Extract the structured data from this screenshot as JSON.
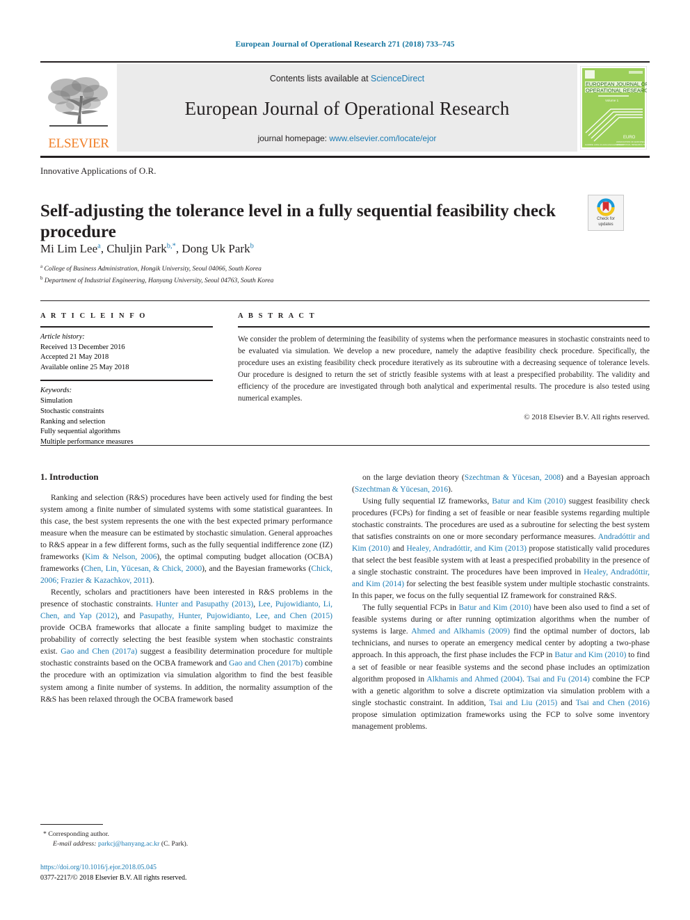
{
  "running_head": "European Journal of Operational Research 271 (2018) 733–745",
  "masthead": {
    "contents_prefix": "Contents lists available at ",
    "contents_link": "ScienceDirect",
    "journal_name": "European Journal of Operational Research",
    "homepage_prefix": "journal homepage: ",
    "homepage_link": "www.elsevier.com/locate/ejor",
    "publisher_wordmark": "ELSEVIER",
    "cover_title_line1": "EUROPEAN JOURNAL OF",
    "cover_title_line2": "OPERATIONAL RESEARCH",
    "cover_volume": "Volume 1",
    "cover_society": "EURO",
    "cover_society_sub": "ASSOCIATION OF EUROPEAN\nOPERATIONAL RESEARCH SOCIETIES"
  },
  "article": {
    "section_label": "Innovative Applications of O.R.",
    "title": "Self-adjusting the tolerance level in a fully sequential feasibility check procedure",
    "authors_html": "Mi Lim Lee<sup>a</sup>, Chuljin Park<sup>b,*</sup>, Dong Uk Park<sup>b</sup>",
    "affiliation_a": "College of Business Administration, Hongik University, Seoul 04066, South Korea",
    "affiliation_b": "Department of Industrial Engineering, Hanyang University, Seoul 04763, South Korea",
    "crossmark_label_line1": "Check for",
    "crossmark_label_line2": "updates"
  },
  "article_info": {
    "heading": "A R T I C L E   I N F O",
    "history_label": "Article history:",
    "history": [
      "Received 13 December 2016",
      "Accepted 21 May 2018",
      "Available online 25 May 2018"
    ],
    "keywords_label": "Keywords:",
    "keywords": [
      "Simulation",
      "Stochastic constraints",
      "Ranking and selection",
      "Fully sequential algorithms",
      "Multiple performance measures"
    ]
  },
  "abstract": {
    "heading": "A B S T R A C T",
    "text": "We consider the problem of determining the feasibility of systems when the performance measures in stochastic constraints need to be evaluated via simulation. We develop a new procedure, namely the adaptive feasibility check procedure. Specifically, the procedure uses an existing feasibility check procedure iteratively as its subroutine with a decreasing sequence of tolerance levels. Our procedure is designed to return the set of strictly feasible systems with at least a prespecified probability. The validity and efficiency of the procedure are investigated through both analytical and experimental results. The procedure is also tested using numerical examples.",
    "copyright": "© 2018 Elsevier B.V. All rights reserved."
  },
  "body": {
    "section_title": "1. Introduction",
    "left_paragraphs_html": [
      "Ranking and selection (R&amp;S) procedures have been actively used for finding the best system among a finite number of simulated systems with some statistical guarantees. In this case, the best system represents the one with the best expected primary performance measure when the measure can be estimated by stochastic simulation. General approaches to R&amp;S appear in a few different forms, such as the fully sequential indifference zone (IZ) frameworks (<span class=\"link\">Kim &amp; Nelson, 2006</span>), the optimal computing budget allocation (OCBA) frameworks (<span class=\"link\">Chen, Lin, Yücesan, &amp; Chick, 2000</span>), and the Bayesian frameworks (<span class=\"link\">Chick, 2006; Frazier &amp; Kazachkov, 2011</span>).",
      "Recently, scholars and practitioners have been interested in R&amp;S problems in the presence of stochastic constraints. <span class=\"link\">Hunter and Pasupathy (2013)</span>, <span class=\"link\">Lee, Pujowidianto, Li, Chen, and Yap (2012)</span>, and <span class=\"link\">Pasupathy, Hunter, Pujowidianto, Lee, and Chen (2015)</span> provide OCBA frameworks that allocate a finite sampling budget to maximize the probability of correctly selecting the best feasible system when stochastic constraints exist. <span class=\"link\">Gao and Chen (2017a)</span> suggest a feasibility determination procedure for multiple stochastic constraints based on the OCBA framework and <span class=\"link\">Gao and Chen (2017b)</span> combine the procedure with an optimization via simulation algorithm to find the best feasible system among a finite number of systems. In addition, the normality assumption of the R&amp;S has been relaxed through the OCBA framework based"
    ],
    "right_paragraphs_html": [
      "on the large deviation theory (<span class=\"link\">Szechtman &amp; Yücesan, 2008</span>) and a Bayesian approach (<span class=\"link\">Szechtman &amp; Yücesan, 2016</span>).",
      "Using fully sequential IZ frameworks, <span class=\"link\">Batur and Kim (2010)</span> suggest feasibility check procedures (FCPs) for finding a set of feasible or near feasible systems regarding multiple stochastic constraints. The procedures are used as a subroutine for selecting the best system that satisfies constraints on one or more secondary performance measures. <span class=\"link\">Andradóttir and Kim (2010)</span> and <span class=\"link\">Healey, Andradóttir, and Kim (2013)</span> propose statistically valid procedures that select the best feasible system with at least a prespecified probability in the presence of a single stochastic constraint. The procedures have been improved in <span class=\"link\">Healey, Andradóttir, and Kim (2014)</span> for selecting the best feasible system under multiple stochastic constraints. In this paper, we focus on the fully sequential IZ framework for constrained R&amp;S.",
      "The fully sequential FCPs in <span class=\"link\">Batur and Kim (2010)</span> have been also used to find a set of feasible systems during or after running optimization algorithms when the number of systems is large. <span class=\"link\">Ahmed and Alkhamis (2009)</span> find the optimal number of doctors, lab technicians, and nurses to operate an emergency medical center by adopting a two-phase approach. In this approach, the first phase includes the FCP in <span class=\"link\">Batur and Kim (2010)</span> to find a set of feasible or near feasible systems and the second phase includes an optimization algorithm proposed in <span class=\"link\">Alkhamis and Ahmed (2004)</span>. <span class=\"link\">Tsai and Fu (2014)</span> combine the FCP with a genetic algorithm to solve a discrete optimization via simulation problem with a single stochastic constraint. In addition, <span class=\"link\">Tsai and Liu (2015)</span> and <span class=\"link\">Tsai and Chen (2016)</span> propose simulation optimization frameworks using the FCP to solve some inventory management problems."
    ]
  },
  "footer": {
    "corresponding_marker": "*",
    "corresponding_label": "Corresponding author.",
    "email_label": "E-mail address:",
    "email": "parkcj@hanyang.ac.kr",
    "email_owner": "(C. Park).",
    "doi": "https://doi.org/10.1016/j.ejor.2018.05.045",
    "issn_line": "0377-2217/© 2018 Elsevier B.V. All rights reserved."
  },
  "colors": {
    "link": "#1c7cb4",
    "running_head": "#12739e",
    "elsevier_orange": "#f07e26",
    "cover_green": "#8cc63f",
    "rule": "#231f20"
  }
}
